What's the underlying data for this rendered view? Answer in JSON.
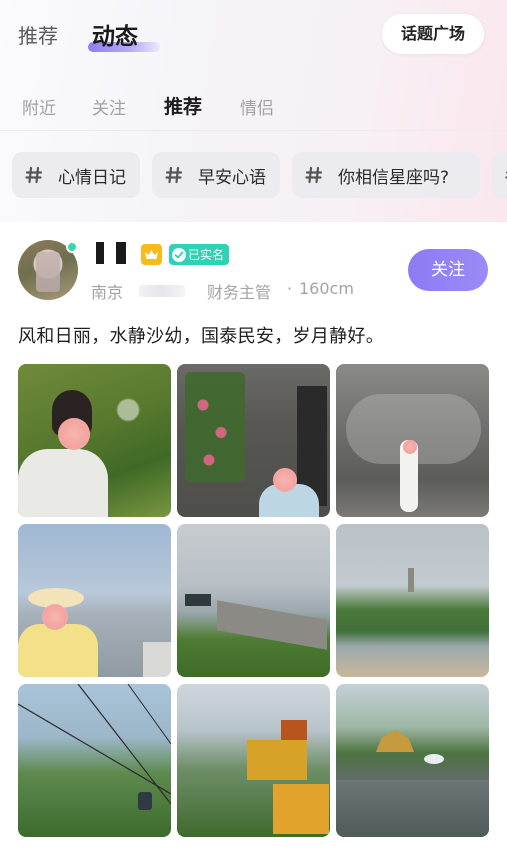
{
  "top_tabs": {
    "items": [
      {
        "label": "推荐",
        "active": false
      },
      {
        "label": "动态",
        "active": true
      }
    ]
  },
  "topic_plaza_button": {
    "label": "话题广场"
  },
  "sub_tabs": {
    "items": [
      {
        "label": "附近",
        "active": false
      },
      {
        "label": "关注",
        "active": false
      },
      {
        "label": "推荐",
        "active": true
      },
      {
        "label": "情侣",
        "active": false
      }
    ]
  },
  "topic_chips": [
    {
      "label": "心情日记"
    },
    {
      "label": "早安心语"
    },
    {
      "label": "你相信星座吗?"
    }
  ],
  "post": {
    "user": {
      "online": true,
      "vip_badge_icon": "crown-icon",
      "verified_label": "已实名",
      "city": "南京",
      "job": "财务主管",
      "separator": "·",
      "height": "160cm"
    },
    "follow_label": "关注",
    "text": "风和日丽，水静沙幼，国泰民安，岁月静好。",
    "photo_count": 9
  },
  "colors": {
    "accent": "#8b7cf6",
    "verified": "#2ed2b5",
    "vip": "#f8b91d",
    "online": "#3ad6a8"
  }
}
